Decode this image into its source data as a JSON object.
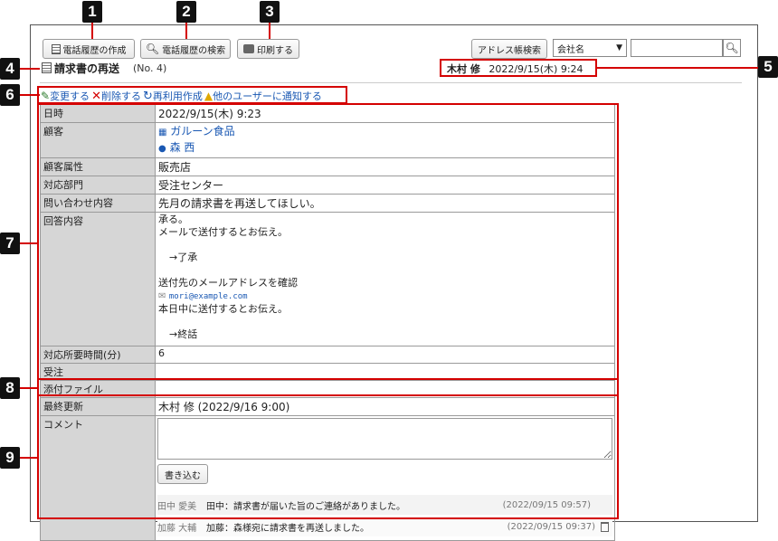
{
  "toolbar": {
    "create_call_history": "電話履歴の作成",
    "search_call_history": "電話履歴の検索",
    "print": "印刷する",
    "address_search": "アドレス帳検索",
    "company_select_value": "会社名",
    "company_select_options": [
      "会社名"
    ],
    "search_placeholder": ""
  },
  "header": {
    "title": "請求書の再送",
    "number": "(No. 4)",
    "author": "木村 修",
    "datetime": "2022/9/15(木) 9:24"
  },
  "actions": {
    "edit": "変更する",
    "delete": "削除する",
    "reuse": "再利用作成",
    "notify": "他のユーザーに通知する"
  },
  "detail": {
    "datetime_label": "日時",
    "datetime_value": "2022/9/15(木) 9:23",
    "customer_label": "顧客",
    "customer_company": "ガルーン食品",
    "customer_person": "森 西",
    "attribute_label": "顧客属性",
    "attribute_value": "販売店",
    "dept_label": "対応部門",
    "dept_value": "受注センター",
    "inquiry_label": "問い合わせ内容",
    "inquiry_value": "先月の請求書を再送してほしい。",
    "answer_label": "回答内容",
    "answer_line1": "承る。",
    "answer_line2": "メールで送付するとお伝え。",
    "answer_line3": "→了承",
    "answer_line4": "送付先のメールアドレスを確認",
    "answer_email": "mori@example.com",
    "answer_line5": "本日中に送付するとお伝え。",
    "answer_line6": "→終話",
    "time_label": "対応所要時間(分)",
    "time_value": "6",
    "order_label": "受注",
    "order_value": "",
    "attach_label": "添付ファイル",
    "attach_value": "",
    "updated_label": "最終更新",
    "updated_value": "木村 修 (2022/9/16 9:00)",
    "comment_label": "コメント"
  },
  "comments": {
    "write_button": "書き込む",
    "items": [
      {
        "author": "田中 愛美",
        "text": "田中：請求書が届いた旨のご連絡がありました。",
        "date": "(2022/09/15 09:57)"
      },
      {
        "author": "加藤 大輔",
        "text": "加藤：森様宛に請求書を再送しました。",
        "date": "(2022/09/15 09:37)"
      }
    ]
  },
  "badges": [
    "1",
    "2",
    "3",
    "4",
    "5",
    "6",
    "7",
    "8",
    "9"
  ],
  "colors": {
    "annotation_red": "#d40000",
    "link_blue": "#1a58b3",
    "label_bg": "#d6d6d6"
  }
}
